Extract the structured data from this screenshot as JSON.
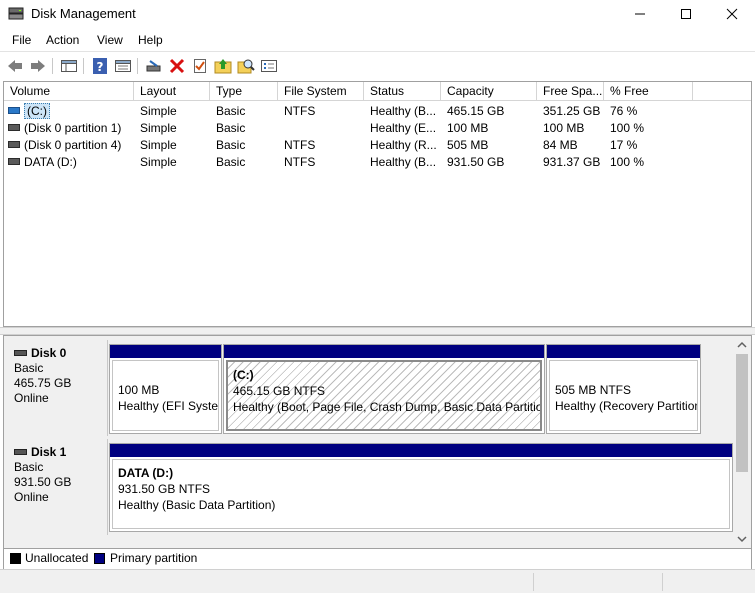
{
  "window": {
    "title": "Disk Management",
    "controls": [
      "minimize",
      "maximize",
      "close"
    ]
  },
  "menu": {
    "items": [
      {
        "label": "File"
      },
      {
        "label": "Action"
      },
      {
        "label": "View"
      },
      {
        "label": "Help"
      }
    ]
  },
  "toolbar": {
    "icons": [
      "back-icon",
      "forward-icon",
      "show-hide-console-tree-icon",
      "help-icon",
      "properties-icon",
      "connect-disk-icon",
      "delete-icon",
      "check-icon",
      "folder-up-icon",
      "search-icon",
      "list-icon"
    ]
  },
  "volume_list": {
    "columns": [
      "Volume",
      "Layout",
      "Type",
      "File System",
      "Status",
      "Capacity",
      "Free Spa...",
      "% Free"
    ],
    "rows": [
      {
        "volume": "(C:)",
        "layout": "Simple",
        "type": "Basic",
        "fs": "NTFS",
        "status": "Healthy (B...",
        "capacity": "465.15 GB",
        "free": "351.25 GB",
        "pct": "76 %",
        "selected": true
      },
      {
        "volume": "(Disk 0 partition 1)",
        "layout": "Simple",
        "type": "Basic",
        "fs": "",
        "status": "Healthy (E...",
        "capacity": "100 MB",
        "free": "100 MB",
        "pct": "100 %",
        "selected": false
      },
      {
        "volume": "(Disk 0 partition 4)",
        "layout": "Simple",
        "type": "Basic",
        "fs": "NTFS",
        "status": "Healthy (R...",
        "capacity": "505 MB",
        "free": "84 MB",
        "pct": "17 %",
        "selected": false
      },
      {
        "volume": "DATA (D:)",
        "layout": "Simple",
        "type": "Basic",
        "fs": "NTFS",
        "status": "Healthy (B...",
        "capacity": "931.50 GB",
        "free": "931.37 GB",
        "pct": "100 %",
        "selected": false
      }
    ]
  },
  "disks": [
    {
      "name": "Disk 0",
      "type": "Basic",
      "size": "465.75 GB",
      "state": "Online",
      "partitions": [
        {
          "name": "",
          "size": "100 MB",
          "status": "Healthy (EFI System Partition)"
        },
        {
          "name": "(C:)",
          "size": "465.15 GB NTFS",
          "status": "Healthy (Boot, Page File, Crash Dump, Basic Data Partition)"
        },
        {
          "name": "",
          "size": "505 MB NTFS",
          "status": "Healthy (Recovery Partition)"
        }
      ]
    },
    {
      "name": "Disk 1",
      "type": "Basic",
      "size": "931.50 GB",
      "state": "Online",
      "partitions": [
        {
          "name": "DATA  (D:)",
          "size": "931.50 GB NTFS",
          "status": "Healthy (Basic Data Partition)"
        }
      ]
    }
  ],
  "legend": {
    "items": [
      {
        "label": "Unallocated",
        "color": "#000000"
      },
      {
        "label": "Primary partition",
        "color": "#000080"
      }
    ]
  },
  "colors": {
    "primary_partition": "#000080",
    "unallocated": "#000000",
    "selection": "#cce4f7"
  }
}
